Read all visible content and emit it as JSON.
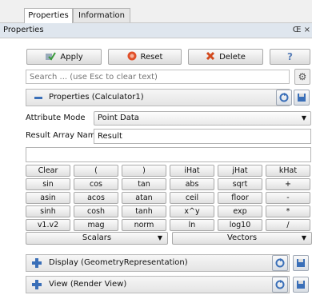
{
  "tabs": [
    "Properties",
    "Information"
  ],
  "panel": {
    "title": "Properties",
    "controls": "Œ ×"
  },
  "toolbar": {
    "apply": "Apply",
    "reset": "Reset",
    "delete": "Delete",
    "help": "?"
  },
  "search": {
    "placeholder": "Search ... (use Esc to clear text)"
  },
  "sections": {
    "properties": "Properties (Calculator1)",
    "display": "Display (GeometryRepresentation)",
    "view": "View (Render View)"
  },
  "calculator": {
    "attribute_mode_label": "Attribute Mode",
    "attribute_mode_value": "Point Data",
    "result_array_label": "Result Array Name",
    "result_array_value": "Result",
    "expression_value": "",
    "keys": [
      [
        "Clear",
        "(",
        ")",
        "iHat",
        "jHat",
        "kHat"
      ],
      [
        "sin",
        "cos",
        "tan",
        "abs",
        "sqrt",
        "+"
      ],
      [
        "asin",
        "acos",
        "atan",
        "ceil",
        "floor",
        "-"
      ],
      [
        "sinh",
        "cosh",
        "tanh",
        "x^y",
        "exp",
        "*"
      ],
      [
        "v1.v2",
        "mag",
        "norm",
        "ln",
        "log10",
        "/"
      ]
    ],
    "scalars": "Scalars",
    "vectors": "Vectors"
  },
  "colors": {
    "accent": "#3a6fb8",
    "panel_bg": "#dfe6ee"
  }
}
